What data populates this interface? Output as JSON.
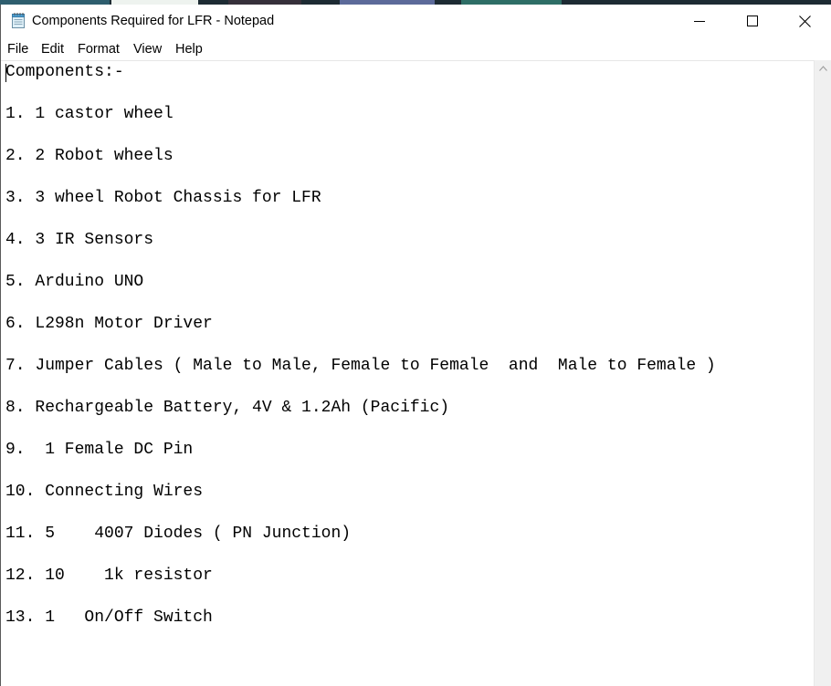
{
  "window": {
    "title": "Components Required for LFR - Notepad",
    "icons": {
      "app": "notepad-icon",
      "minimize": "minimize-icon",
      "maximize": "maximize-icon",
      "close": "close-icon"
    }
  },
  "menu": {
    "items": [
      {
        "label": "File"
      },
      {
        "label": "Edit"
      },
      {
        "label": "Format"
      },
      {
        "label": "View"
      },
      {
        "label": "Help"
      }
    ]
  },
  "document": {
    "lines": [
      "Components:-",
      "1. 1 castor wheel",
      "2. 2 Robot wheels",
      "3. 3 wheel Robot Chassis for LFR",
      "4. 3 IR Sensors",
      "5. Arduino UNO",
      "6. L298n Motor Driver",
      "7. Jumper Cables ( Male to Male, Female to Female  and  Male to Female )",
      "8. Rechargeable Battery, 4V & 1.2Ah (Pacific)",
      "9.  1 Female DC Pin",
      "10. Connecting Wires",
      "11. 5    4007 Diodes ( PN Junction)",
      "12. 10    1k resistor",
      "13. 1   On/Off Switch"
    ]
  },
  "colors": {
    "text": "#000000",
    "window_bg": "#ffffff",
    "scrollbar_bg": "#f0f0f0",
    "desktop_strip": "#1d2b33"
  }
}
